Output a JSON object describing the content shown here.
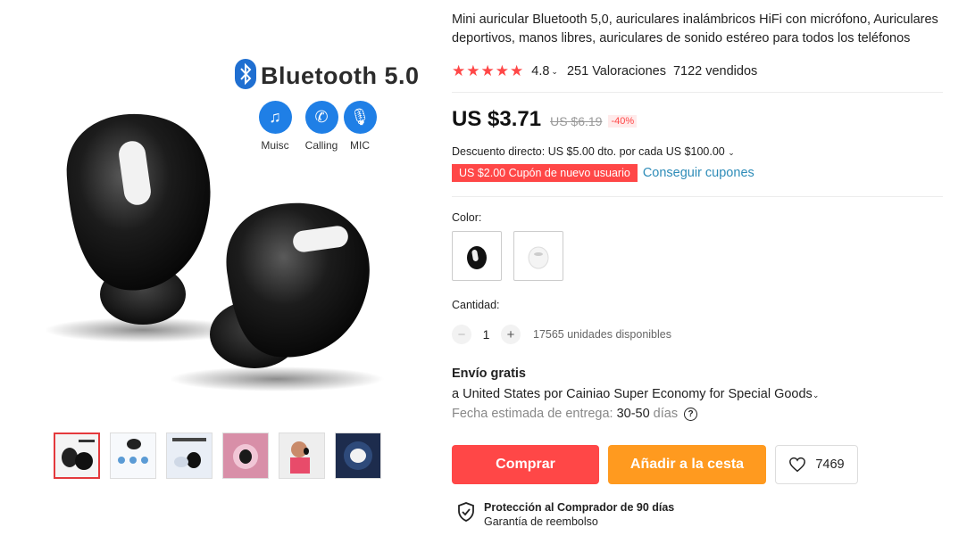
{
  "gallery": {
    "banner": {
      "title": "Bluetooth 5.0"
    },
    "features": [
      {
        "icon": "music-note-icon",
        "label": "Muisc"
      },
      {
        "icon": "phone-call-icon",
        "label": "Calling"
      },
      {
        "icon": "microphone-icon",
        "label": "MIC"
      }
    ],
    "thumbnails": [
      {
        "name": "thumb-1",
        "active": true
      },
      {
        "name": "thumb-2",
        "active": false
      },
      {
        "name": "thumb-3",
        "active": false
      },
      {
        "name": "thumb-4",
        "active": false
      },
      {
        "name": "thumb-5",
        "active": false
      },
      {
        "name": "thumb-6",
        "active": false
      }
    ]
  },
  "product": {
    "title": "Mini auricular Bluetooth 5,0, auriculares inalámbricos HiFi con micrófono, Auriculares deportivos, manos libres, auriculares de sonido estéreo para todos los teléfonos",
    "rating": {
      "score": "4.8",
      "stars": 5,
      "reviews": "251 Valoraciones",
      "sold": "7122 vendidos"
    },
    "price": {
      "current": "US $3.71",
      "original": "US $6.19",
      "discount": "-40%"
    },
    "direct_discount": "Descuento directo: US $5.00 dto. por cada US $100.00",
    "coupon": {
      "label": "US $2.00 Cupón de nuevo usuario",
      "link": "Conseguir cupones"
    },
    "color": {
      "label": "Color:",
      "options": [
        "black",
        "white"
      ],
      "selected": "black"
    },
    "quantity": {
      "label": "Cantidad:",
      "value": "1",
      "stock": "17565 unidades disponibles"
    },
    "shipping": {
      "title": "Envío gratis",
      "destination": "a United States por Cainiao Super Economy for Special Goods",
      "eta_label": "Fecha estimada de entrega:",
      "eta_value": "30-50",
      "eta_unit": "días"
    },
    "actions": {
      "buy": "Comprar",
      "cart": "Añadir a la cesta",
      "wishlist_count": "7469"
    },
    "protection": {
      "title": "Protección al Comprador de 90 días",
      "subtitle": "Garantía de reembolso"
    }
  },
  "colors": {
    "accent": "#ff4747",
    "orange": "#ff9a1f",
    "link": "#2e8cb8",
    "feature_blue": "#1f7fe6"
  }
}
